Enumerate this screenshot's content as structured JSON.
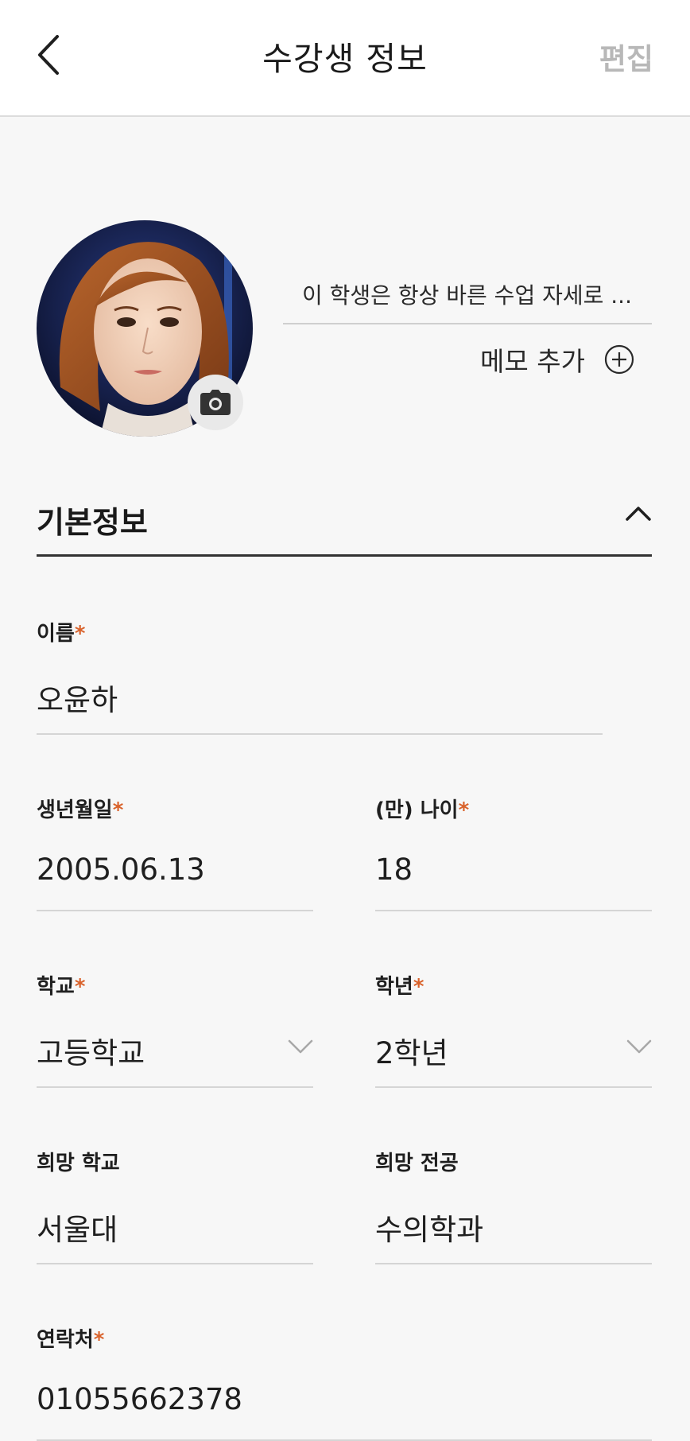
{
  "header": {
    "title": "수강생 정보",
    "edit_label": "편집"
  },
  "profile": {
    "memo_preview": "이 학생은 항상 바른 수업 자세로 ...",
    "memo_add_label": "메모 추가"
  },
  "section": {
    "title": "기본정보",
    "expanded": true
  },
  "fields": {
    "name": {
      "label": "이름",
      "required": "*",
      "value": "오윤하"
    },
    "birthdate": {
      "label": "생년월일",
      "required": "*",
      "value": "2005.06.13"
    },
    "age": {
      "label": "(만) 나이",
      "required": "*",
      "value": "18"
    },
    "school": {
      "label": "학교",
      "required": "*",
      "value": "고등학교"
    },
    "grade": {
      "label": "학년",
      "required": "*",
      "value": "2학년"
    },
    "desired_school": {
      "label": "희망 학교",
      "value": "서울대"
    },
    "desired_major": {
      "label": "희망 전공",
      "value": "수의학과"
    },
    "contact": {
      "label": "연락처",
      "required": "*",
      "value": "01055662378"
    }
  },
  "colors": {
    "required_accent": "#d9622b",
    "edit_disabled": "#b8b8b8",
    "background": "#f7f7f7"
  },
  "icons": {
    "back": "chevron-left-icon",
    "camera": "camera-icon",
    "memo_add": "plus-circle-icon",
    "collapse": "chevron-up-icon",
    "dropdown": "chevron-down-icon"
  }
}
